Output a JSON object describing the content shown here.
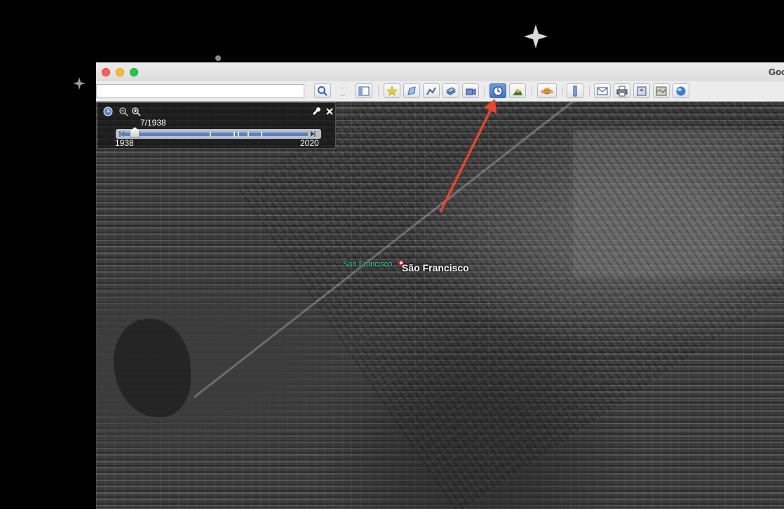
{
  "window": {
    "title": "Goo"
  },
  "search": {
    "value": "",
    "placeholder": ""
  },
  "toolbar": {
    "buttons": [
      {
        "name": "search",
        "icon": "magnifier-icon"
      },
      {
        "name": "sidebar-toggle",
        "icon": "sidebar-icon"
      },
      {
        "name": "add-placemark",
        "icon": "pushpin-icon"
      },
      {
        "name": "add-polygon",
        "icon": "polygon-icon"
      },
      {
        "name": "add-path",
        "icon": "path-icon"
      },
      {
        "name": "add-image-overlay",
        "icon": "overlay-icon"
      },
      {
        "name": "record-tour",
        "icon": "record-tour-icon"
      },
      {
        "name": "historical-imagery",
        "icon": "clock-icon",
        "active": true
      },
      {
        "name": "sunlight",
        "icon": "sunlight-icon"
      },
      {
        "name": "planets",
        "icon": "planet-icon"
      },
      {
        "name": "ruler",
        "icon": "ruler-icon"
      },
      {
        "name": "email",
        "icon": "envelope-icon"
      },
      {
        "name": "print",
        "icon": "printer-icon"
      },
      {
        "name": "save-image",
        "icon": "save-image-icon"
      },
      {
        "name": "view-in-maps",
        "icon": "map-view-icon"
      },
      {
        "name": "earth",
        "icon": "globe-icon"
      }
    ]
  },
  "time_slider": {
    "current_date": "7/1938",
    "start_year": "1938",
    "end_year": "2020",
    "position": 0.05
  },
  "map": {
    "labels": {
      "small": "San Francisco",
      "main": "São Francisco"
    }
  },
  "annotation": {
    "arrow_color": "#e8452c"
  },
  "colors": {
    "active_button": "#4a82d4",
    "label_green": "#38d39f"
  }
}
